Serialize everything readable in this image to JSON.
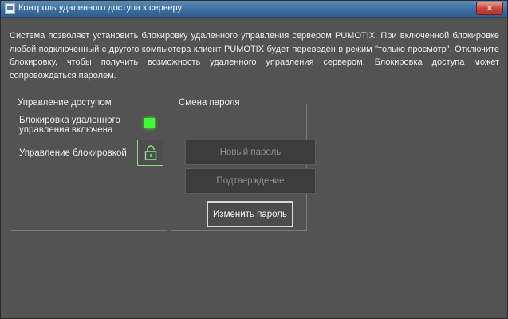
{
  "window": {
    "title": "Контроль удаленного доступа к серверу",
    "close_label": "✕"
  },
  "description": "Система позволяет установить блокировку удаленного управления сервером PUMOTIX. При включенной блокировке любой подключенный с другого компьютера клиент PUMOTIX будет переведен в режим \"только просмотр\". Отключите блокировку, чтобы получить возможность удаленного управления сервером. Блокировка доступа может сопровождаться паролем.",
  "access_group": {
    "title": "Управление доступом",
    "lock_status_label": "Блокировка удаленного управления включена",
    "lock_status_color": "#3dfb37",
    "lock_control_label": "Управление блокировкой",
    "lock_icon": "unlocked-padlock-icon"
  },
  "password_group": {
    "title": "Смена пароля",
    "new_password_placeholder": "Новый пароль",
    "confirm_placeholder": "Подтверждение",
    "change_button_label": "Изменить пароль"
  }
}
